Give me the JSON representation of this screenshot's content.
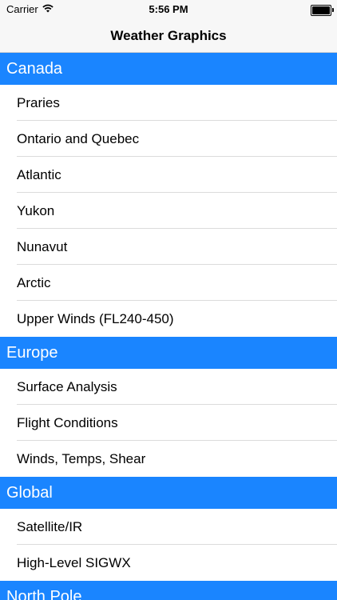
{
  "status_bar": {
    "carrier": "Carrier",
    "time": "5:56 PM"
  },
  "nav": {
    "title": "Weather Graphics"
  },
  "sections": [
    {
      "title": "Canada",
      "items": [
        "Praries",
        "Ontario and Quebec",
        "Atlantic",
        "Yukon",
        "Nunavut",
        "Arctic",
        "Upper Winds (FL240-450)"
      ]
    },
    {
      "title": "Europe",
      "items": [
        "Surface Analysis",
        "Flight Conditions",
        "Winds, Temps, Shear"
      ]
    },
    {
      "title": "Global",
      "items": [
        "Satellite/IR",
        "High-Level SIGWX"
      ]
    },
    {
      "title": "North Pole",
      "items": []
    }
  ],
  "colors": {
    "section_header_bg": "#1a85ff",
    "section_header_text": "#ffffff"
  },
  "icons": {
    "wifi": "wifi-icon",
    "battery": "battery-icon"
  }
}
